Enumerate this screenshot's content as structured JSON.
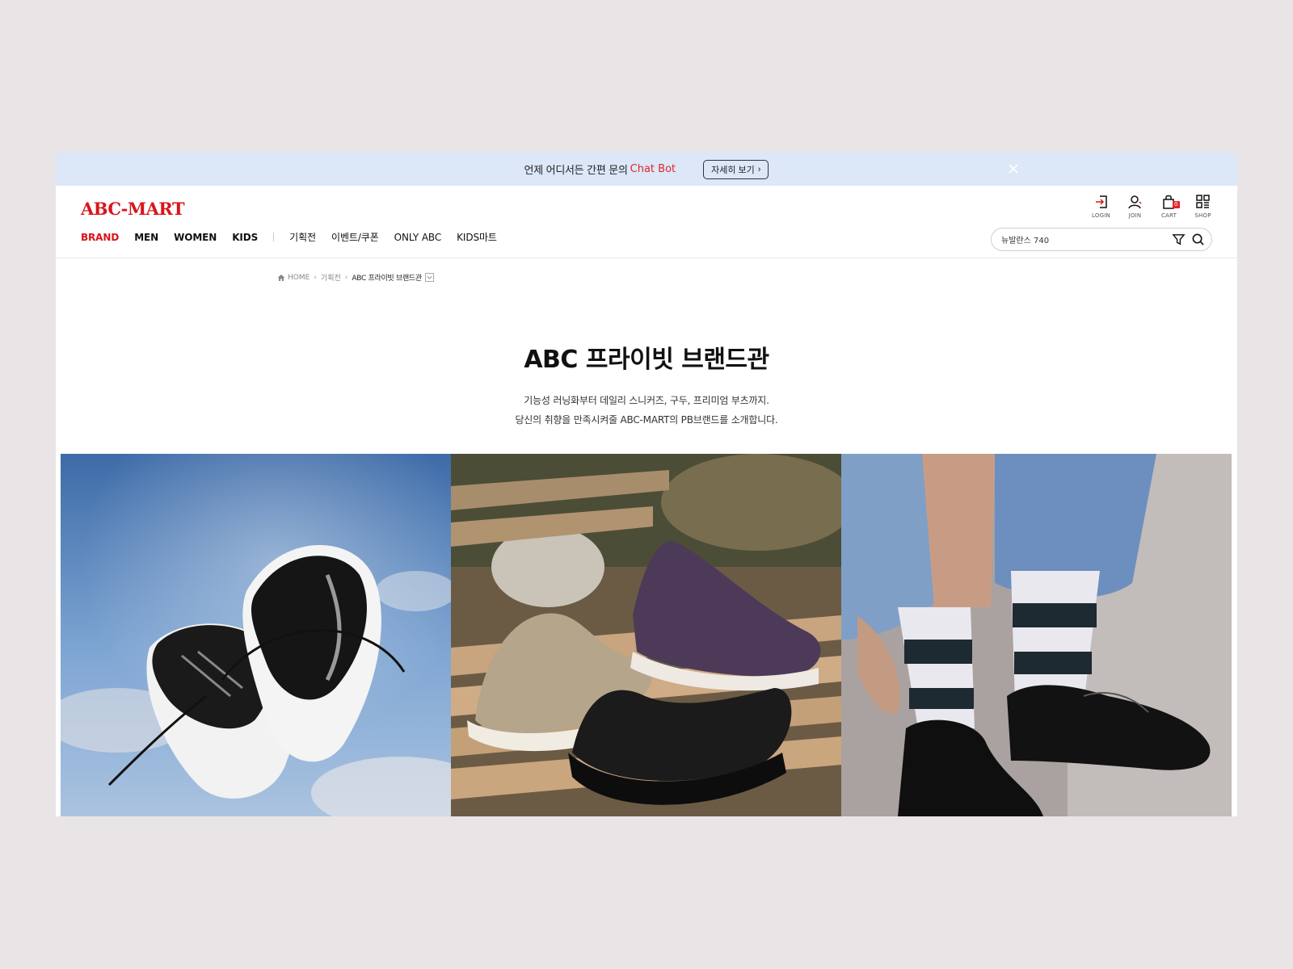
{
  "banner": {
    "text": "언제 어디서든 간편 문의",
    "accent": "Chat Bot",
    "button_label": "자세히 보기"
  },
  "header": {
    "logo": "ABC-MART",
    "util": [
      {
        "label": "LOGIN",
        "icon": "login-icon"
      },
      {
        "label": "JOIN",
        "icon": "join-icon"
      },
      {
        "label": "CART",
        "icon": "cart-icon",
        "count": "0"
      },
      {
        "label": "SHOP",
        "icon": "shop-icon"
      }
    ],
    "nav": {
      "primary": [
        "BRAND",
        "MEN",
        "WOMEN",
        "KIDS"
      ],
      "secondary": [
        "기획전",
        "이벤트/쿠폰",
        "ONLY ABC",
        "KIDS마트"
      ]
    },
    "search": {
      "value": "뉴발란스 740"
    }
  },
  "breadcrumb": {
    "home": "HOME",
    "level1": "기획전",
    "current": "ABC 프라이빗 브랜드관"
  },
  "main": {
    "title": "ABC 프라이빗 브랜드관",
    "desc_line1": "기능성 러닝화부터 데일리 스니커즈, 구두, 프리미엄 부츠까지.",
    "desc_line2": "당신의 취향을 만족시켜줄 ABC-MART의 PB브랜드를 소개합니다."
  },
  "colors": {
    "accent": "#d8151b",
    "banner_bg": "#dce7f8",
    "page_bg": "#e9e4e6"
  }
}
